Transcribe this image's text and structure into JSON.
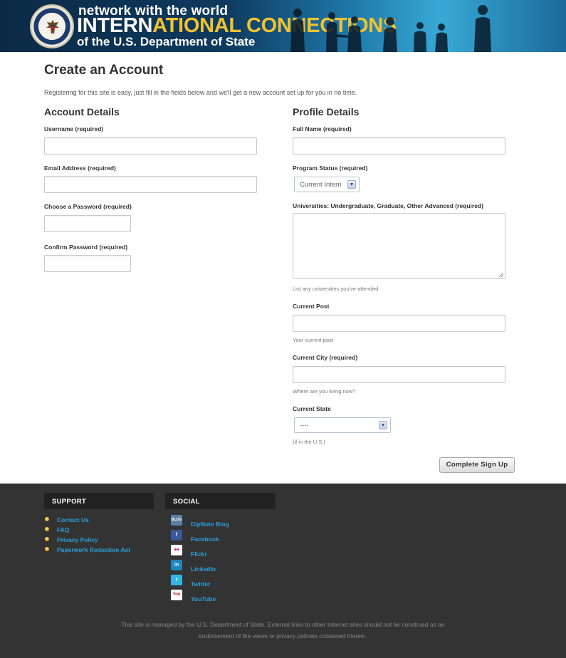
{
  "header": {
    "line1": "network with the world",
    "line2_a": "INTERN",
    "line2_b": "ATIONAL CONNECTIONS",
    "line3": "of the U.S. Department of State"
  },
  "page": {
    "title": "Create an Account",
    "intro": "Registering for this site is easy, just fill in the fields below and we'll get a new account set up for you in no time."
  },
  "account": {
    "heading": "Account Details",
    "username_label": "Username (required)",
    "email_label": "Email Address (required)",
    "password_label": "Choose a Password (required)",
    "confirm_label": "Confirm Password (required)"
  },
  "profile": {
    "heading": "Profile Details",
    "fullname_label": "Full Name (required)",
    "status_label": "Program Status (required)",
    "status_value": "Current Intern",
    "universities_label": "Universities: Undergraduate, Graduate, Other Advanced (required)",
    "universities_hint": "List any universities you've attended",
    "post_label": "Current Post",
    "post_hint": "Your current post",
    "city_label": "Current City (required)",
    "city_hint": "Where are you living now?",
    "state_label": "Current State",
    "state_value": "----",
    "state_hint": "(if in the U.S.)"
  },
  "submit_label": "Complete Sign Up",
  "footer": {
    "support_heading": "SUPPORT",
    "support_links": [
      "Contact Us",
      "FAQ",
      "Privacy Policy",
      "Paperwork Reduction Act"
    ],
    "social_heading": "SOCIAL",
    "social_links": [
      {
        "label": "DipNote Blog",
        "icon": "blog-icon",
        "glyph": "BLOG",
        "color": "#5b7fa6"
      },
      {
        "label": "Facebook",
        "icon": "facebook-icon",
        "glyph": "f",
        "color": "#3b5998"
      },
      {
        "label": "Flickr",
        "icon": "flickr-icon",
        "glyph": "••",
        "color": "#ffffff"
      },
      {
        "label": "LinkedIn",
        "icon": "linkedin-icon",
        "glyph": "in",
        "color": "#1d87bd"
      },
      {
        "label": "Twitter",
        "icon": "twitter-icon",
        "glyph": "t",
        "color": "#33b5e8"
      },
      {
        "label": "YouTube",
        "icon": "youtube-icon",
        "glyph": "You",
        "color": "#ffffff"
      }
    ],
    "disclaimer": "This site is managed by the U.S. Department of State. External links to other Internet sites should not be construed as an endorsement of the views or privacy policies contained therein."
  }
}
